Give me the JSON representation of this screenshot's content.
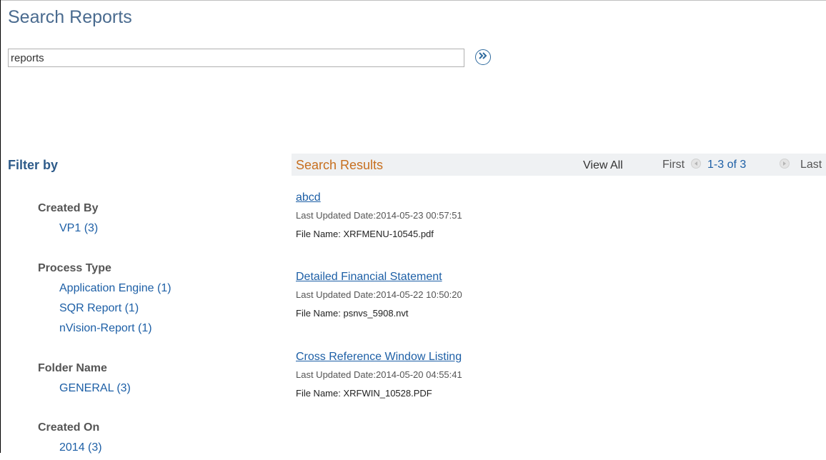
{
  "page": {
    "title": "Search Reports"
  },
  "search": {
    "value": "reports"
  },
  "filters": {
    "title": "Filter by",
    "groups": [
      {
        "label": "Created By",
        "items": [
          "VP1 (3)"
        ]
      },
      {
        "label": "Process Type",
        "items": [
          "Application Engine (1)",
          "SQR Report (1)",
          "nVision-Report (1)"
        ]
      },
      {
        "label": "Folder Name",
        "items": [
          "GENERAL (3)"
        ]
      },
      {
        "label": "Created On",
        "items": [
          "2014 (3)"
        ]
      }
    ]
  },
  "results": {
    "title": "Search Results",
    "view_all": "View All",
    "first": "First",
    "count": "1-3 of 3",
    "last": "Last",
    "items": [
      {
        "title": "abcd",
        "updated": "Last Updated Date:2014-05-23 00:57:51",
        "file": "File Name: XRFMENU-10545.pdf"
      },
      {
        "title": "Detailed Financial Statement",
        "updated": "Last Updated Date:2014-05-22 10:50:20",
        "file": "File Name: psnvs_5908.nvt"
      },
      {
        "title": "Cross Reference Window Listing",
        "updated": "Last Updated Date:2014-05-20 04:55:41",
        "file": "File Name: XRFWIN_10528.PDF"
      }
    ]
  },
  "icons": {
    "search_go": "double-chevron-right-icon",
    "prev": "triangle-left-icon",
    "next": "triangle-right-icon"
  },
  "colors": {
    "title": "#4a6b8f",
    "link": "#1d5fa6",
    "results_title": "#c76f1f",
    "results_bar": "#eff1f3"
  }
}
